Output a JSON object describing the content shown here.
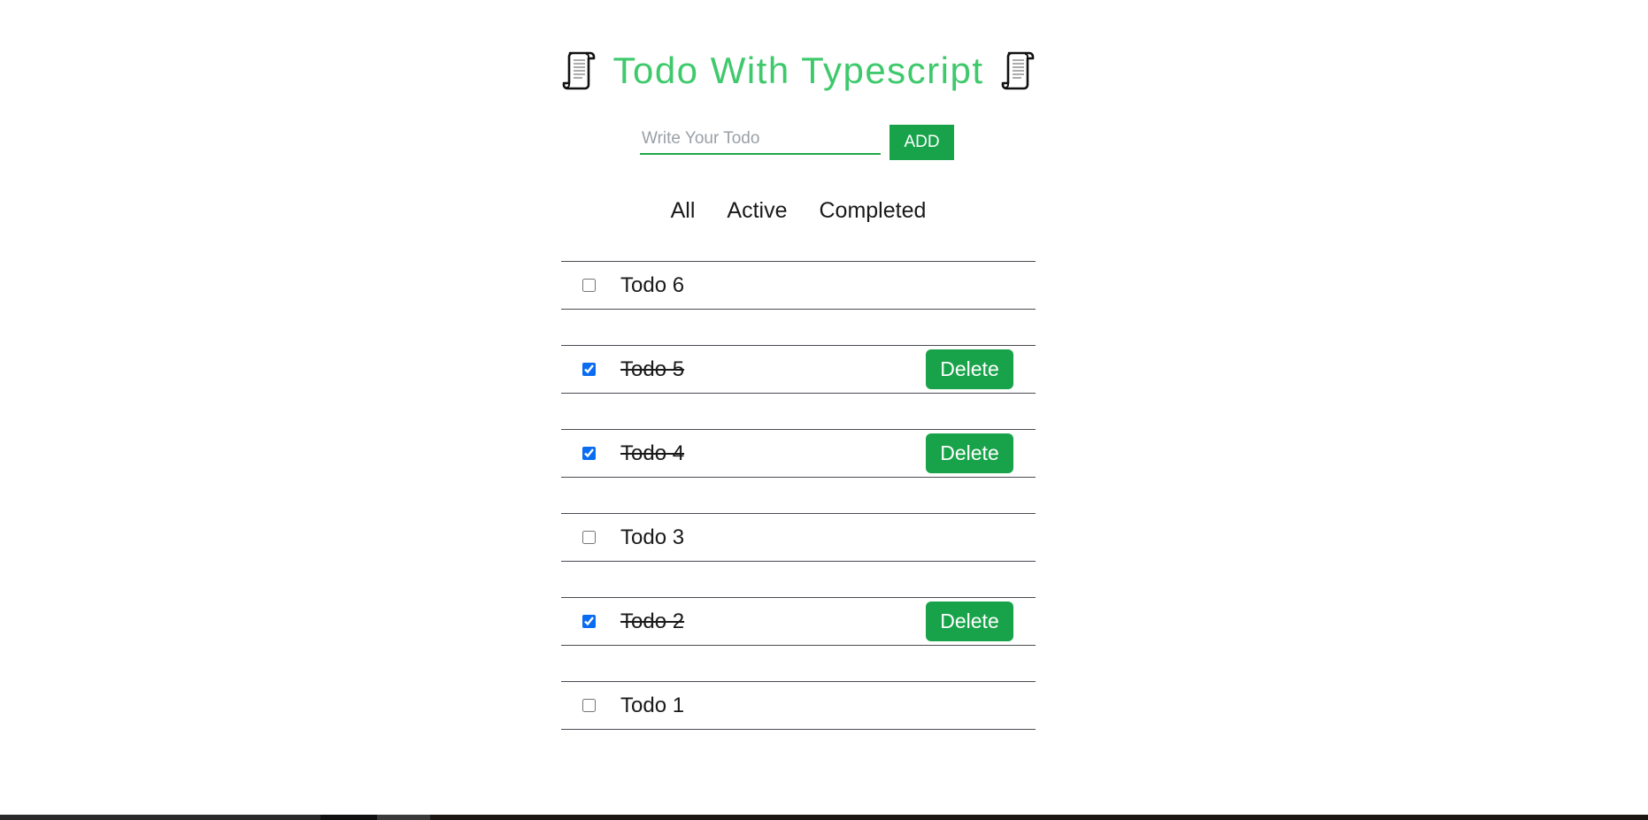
{
  "app": {
    "title": "Todo With Typescript",
    "icon_left": "scroll-icon",
    "icon_right": "scroll-icon"
  },
  "colors": {
    "title": "#3ec96c",
    "accent": "#18a34a",
    "input_border": "#22a54a",
    "checkbox": "#0a6cf0",
    "divider": "#4a4a52"
  },
  "form": {
    "placeholder": "Write Your Todo",
    "value": "",
    "add_label": "ADD"
  },
  "filters": [
    {
      "label": "All"
    },
    {
      "label": "Active"
    },
    {
      "label": "Completed"
    }
  ],
  "todos": [
    {
      "text": "Todo 6",
      "completed": false
    },
    {
      "text": "Todo 5",
      "completed": true
    },
    {
      "text": "Todo 4",
      "completed": true
    },
    {
      "text": "Todo 3",
      "completed": false
    },
    {
      "text": "Todo 2",
      "completed": true
    },
    {
      "text": "Todo 1",
      "completed": false
    }
  ],
  "delete_label": "Delete"
}
